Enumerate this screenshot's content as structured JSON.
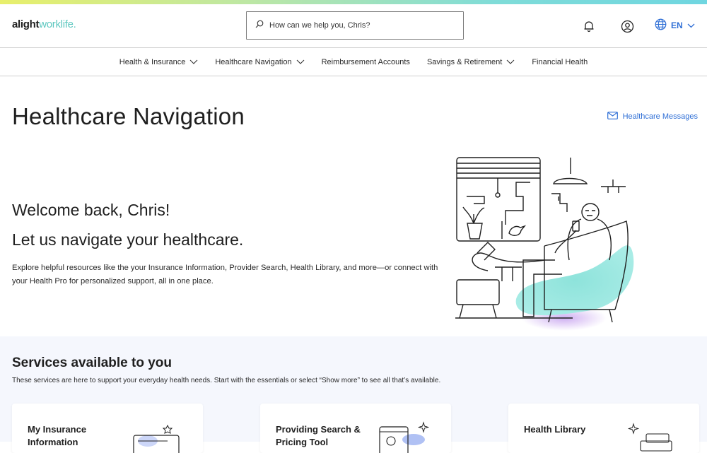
{
  "header": {
    "logo_primary": "alight",
    "logo_secondary": "worklife.",
    "search_placeholder": "How can we help you, Chris?",
    "language": "EN"
  },
  "nav": {
    "items": [
      {
        "label": "Health & Insurance"
      },
      {
        "label": "Healthcare Navigation"
      },
      {
        "label": "Reimbursement Accounts"
      },
      {
        "label": "Savings & Retirement"
      },
      {
        "label": "Financial Health"
      }
    ]
  },
  "page": {
    "title": "Healthcare Navigation",
    "messages_link": "Healthcare Messages"
  },
  "hero": {
    "welcome": "Welcome back, Chris!",
    "tagline": "Let us navigate your healthcare.",
    "description": "Explore helpful resources like the your Insurance Information, Provider Search, Health Library, and more—or connect with your Health Pro for personalized support, all in one place."
  },
  "services": {
    "title": "Services available to you",
    "description": "These services are here to support your everyday health needs. Start with the essentials or select “Show more” to see all that’s available.",
    "cards": [
      {
        "title": "My Insurance Information"
      },
      {
        "title": "Providing Search & Pricing Tool"
      },
      {
        "title": "Health Library"
      }
    ]
  },
  "colors": {
    "accent_blue": "#2f6fd6",
    "teal": "#5fc8c0",
    "services_bg": "#f5f7fd"
  }
}
